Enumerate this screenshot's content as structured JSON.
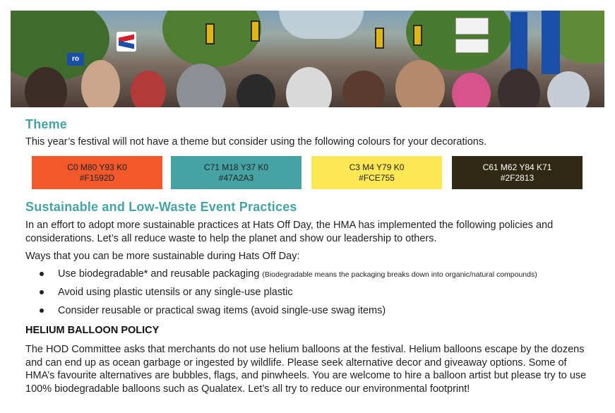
{
  "hero": {
    "image_desc": "street-festival-crowd-photo",
    "signs": [
      "ro"
    ]
  },
  "theme": {
    "heading": "Theme",
    "intro": "This year’s festival will not have a theme but consider using the following colours for your decorations.",
    "swatches": [
      {
        "cmyk": "C0 M80 Y93 K0",
        "hex": "#F1592D",
        "color": "#F1592D"
      },
      {
        "cmyk": "C71 M18 Y37 K0",
        "hex": "#47A2A3",
        "color": "#47A2A3"
      },
      {
        "cmyk": "C3 M4 Y79 K0",
        "hex": "#FCE755",
        "color": "#FCE755"
      },
      {
        "cmyk": "C61 M62 Y84 K71",
        "hex": "#2F2813",
        "color": "#2F2813"
      }
    ]
  },
  "sustain": {
    "heading": "Sustainable and Low-Waste Event Practices",
    "para1": "In an effort to adopt more sustainable practices at Hats Off Day, the HMA has implemented the following policies and considerations. Let’s all reduce waste to help the planet and show our leadership to others.",
    "para2": "Ways that you can be more sustainable during Hats Off Day:",
    "bullets": [
      {
        "main": "Use biodegradable* and reusable packaging ",
        "note": "(Biodegradable means the packaging breaks down into organic/natural compounds)"
      },
      {
        "main": "Avoid using plastic utensils or any single-use plastic",
        "note": ""
      },
      {
        "main": "Consider reusable or practical swag items (avoid single-use swag items)",
        "note": ""
      }
    ]
  },
  "helium": {
    "heading": "HELIUM BALLOON POLICY",
    "para": "The HOD Committee asks that merchants do not use helium balloons at the festival. Helium balloons escape by the dozens and can end up as ocean garbage or ingested by wildlife. Please seek alternative decor and giveaway options. Some of HMA’s favourite alternatives are bubbles, flags, and pinwheels. You are welcome to hire a balloon artist but please try to use 100% biodegradable balloons such as Qualatex. Let’s all try to reduce our environmental footprint!"
  },
  "colors": {
    "heading": "#46A3A3",
    "text": "#222222"
  }
}
